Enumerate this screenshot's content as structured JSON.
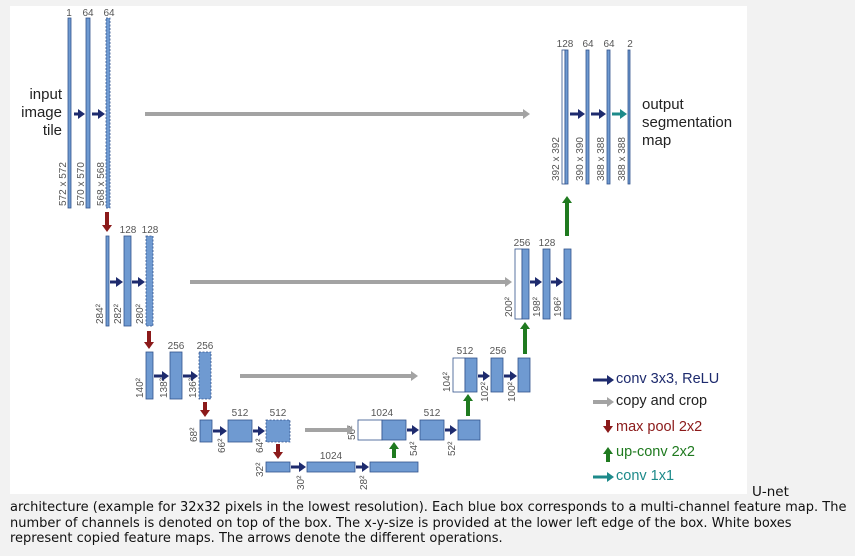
{
  "colors": {
    "box": "#6f9ad1",
    "box_stroke": "#33538c",
    "conv": "#1e2b6e",
    "copy": "#a3a3a3",
    "pool": "#8b1a1a",
    "upconv": "#1f7a1f",
    "conv1x1": "#1d8a8a",
    "label": "#555555"
  },
  "input_label": [
    "input",
    "image",
    "tile"
  ],
  "output_label": [
    "output",
    "segmentation",
    "map"
  ],
  "blocks": [
    {
      "id": "enc1",
      "channels": [
        "1",
        "64",
        "64"
      ],
      "sizes": [
        "572 x 572",
        "570 x 570",
        "568 x 568"
      ]
    },
    {
      "id": "enc2",
      "channels": [
        "",
        "128",
        "128"
      ],
      "sizes": [
        "284²",
        "282²",
        "280²"
      ]
    },
    {
      "id": "enc3",
      "channels": [
        "",
        "256",
        "256"
      ],
      "sizes": [
        "140²",
        "138²",
        "136²"
      ]
    },
    {
      "id": "enc4",
      "channels": [
        "",
        "512",
        "512"
      ],
      "sizes": [
        "68²",
        "66²",
        "64²"
      ]
    },
    {
      "id": "bottom",
      "channels": [
        "",
        "1024",
        ""
      ],
      "sizes": [
        "32²",
        "30²",
        "28²"
      ]
    },
    {
      "id": "dec4",
      "channels": [
        "1024",
        "512",
        ""
      ],
      "sizes": [
        "56²",
        "54²",
        "52²"
      ]
    },
    {
      "id": "dec3",
      "channels": [
        "512",
        "256",
        ""
      ],
      "sizes": [
        "104²",
        "102²",
        "100²"
      ]
    },
    {
      "id": "dec2",
      "channels": [
        "256",
        "128",
        ""
      ],
      "sizes": [
        "200²",
        "198²",
        "196²"
      ]
    },
    {
      "id": "dec1",
      "channels": [
        "128",
        "64",
        "64",
        "2"
      ],
      "sizes": [
        "392 x 392",
        "390 x 390",
        "388 x 388",
        "388 x 388"
      ]
    }
  ],
  "legend": [
    {
      "kind": "conv",
      "label": "conv 3x3, ReLU"
    },
    {
      "kind": "copy",
      "label": "copy and crop"
    },
    {
      "kind": "pool",
      "label": "max pool 2x2"
    },
    {
      "kind": "upconv",
      "label": "up-conv 2x2"
    },
    {
      "kind": "conv1x1",
      "label": "conv 1x1"
    }
  ],
  "caption_tail": "U-net",
  "caption": "architecture (example for 32x32 pixels in the lowest resolution). Each blue box corresponds to a multi-channel feature map. The number of channels is denoted on top of the box. The x-y-size is provided at the lower left edge of the box. White boxes represent copied feature maps. The arrows denote the different operations."
}
